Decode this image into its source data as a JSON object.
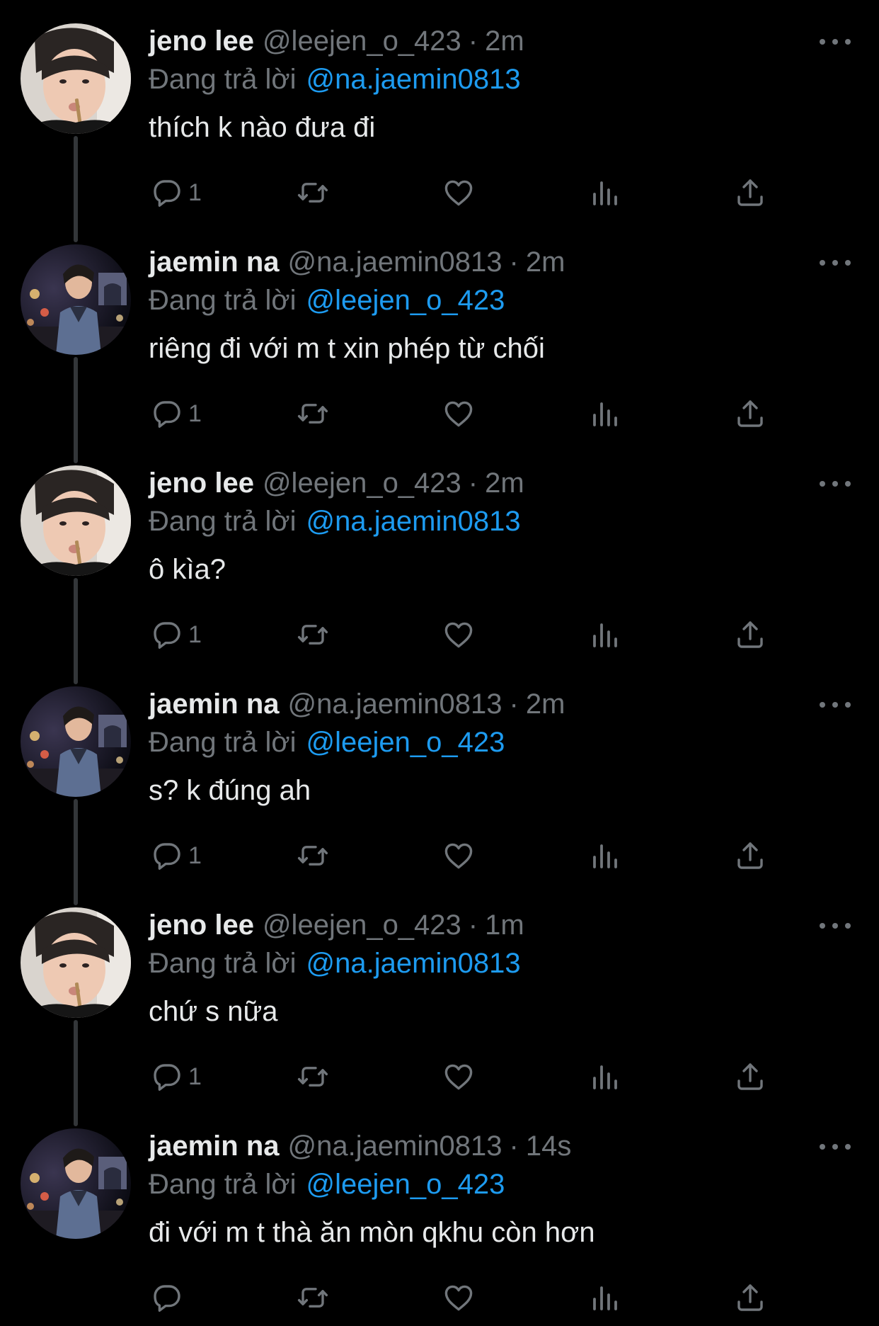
{
  "icons": {
    "reply": "reply-icon",
    "retweet": "retweet-icon",
    "like": "heart-icon",
    "views": "views-icon",
    "share": "share-icon",
    "more": "more-options-icon"
  },
  "colors": {
    "background": "#000000",
    "primary_text": "#e7e9ea",
    "secondary_text": "#71767b",
    "mention": "#1d9bf0",
    "thread_line": "#333639"
  },
  "tweets": [
    {
      "name": "jeno lee",
      "handle": "@leejen_o_423",
      "separator": "·",
      "time": "2m",
      "reply_prefix": "Đang trả lời",
      "reply_to": "@na.jaemin0813",
      "text": "thích k nào đưa đi",
      "reply_count": "1"
    },
    {
      "name": "jaemin na",
      "handle": "@na.jaemin0813",
      "separator": "·",
      "time": "2m",
      "reply_prefix": "Đang trả lời",
      "reply_to": "@leejen_o_423",
      "text": "riêng đi với m t xin phép từ chối",
      "reply_count": "1"
    },
    {
      "name": "jeno lee",
      "handle": "@leejen_o_423",
      "separator": "·",
      "time": "2m",
      "reply_prefix": "Đang trả lời",
      "reply_to": "@na.jaemin0813",
      "text": "ô kìa?",
      "reply_count": "1"
    },
    {
      "name": "jaemin na",
      "handle": "@na.jaemin0813",
      "separator": "·",
      "time": "2m",
      "reply_prefix": "Đang trả lời",
      "reply_to": "@leejen_o_423",
      "text": "s? k đúng ah",
      "reply_count": "1"
    },
    {
      "name": "jeno lee",
      "handle": "@leejen_o_423",
      "separator": "·",
      "time": "1m",
      "reply_prefix": "Đang trả lời",
      "reply_to": "@na.jaemin0813",
      "text": "chứ s nữa",
      "reply_count": "1"
    },
    {
      "name": "jaemin na",
      "handle": "@na.jaemin0813",
      "separator": "·",
      "time": "14s",
      "reply_prefix": "Đang trả lời",
      "reply_to": "@leejen_o_423",
      "text": "đi với m t thà ăn mòn qkhu còn hơn",
      "reply_count": ""
    }
  ]
}
